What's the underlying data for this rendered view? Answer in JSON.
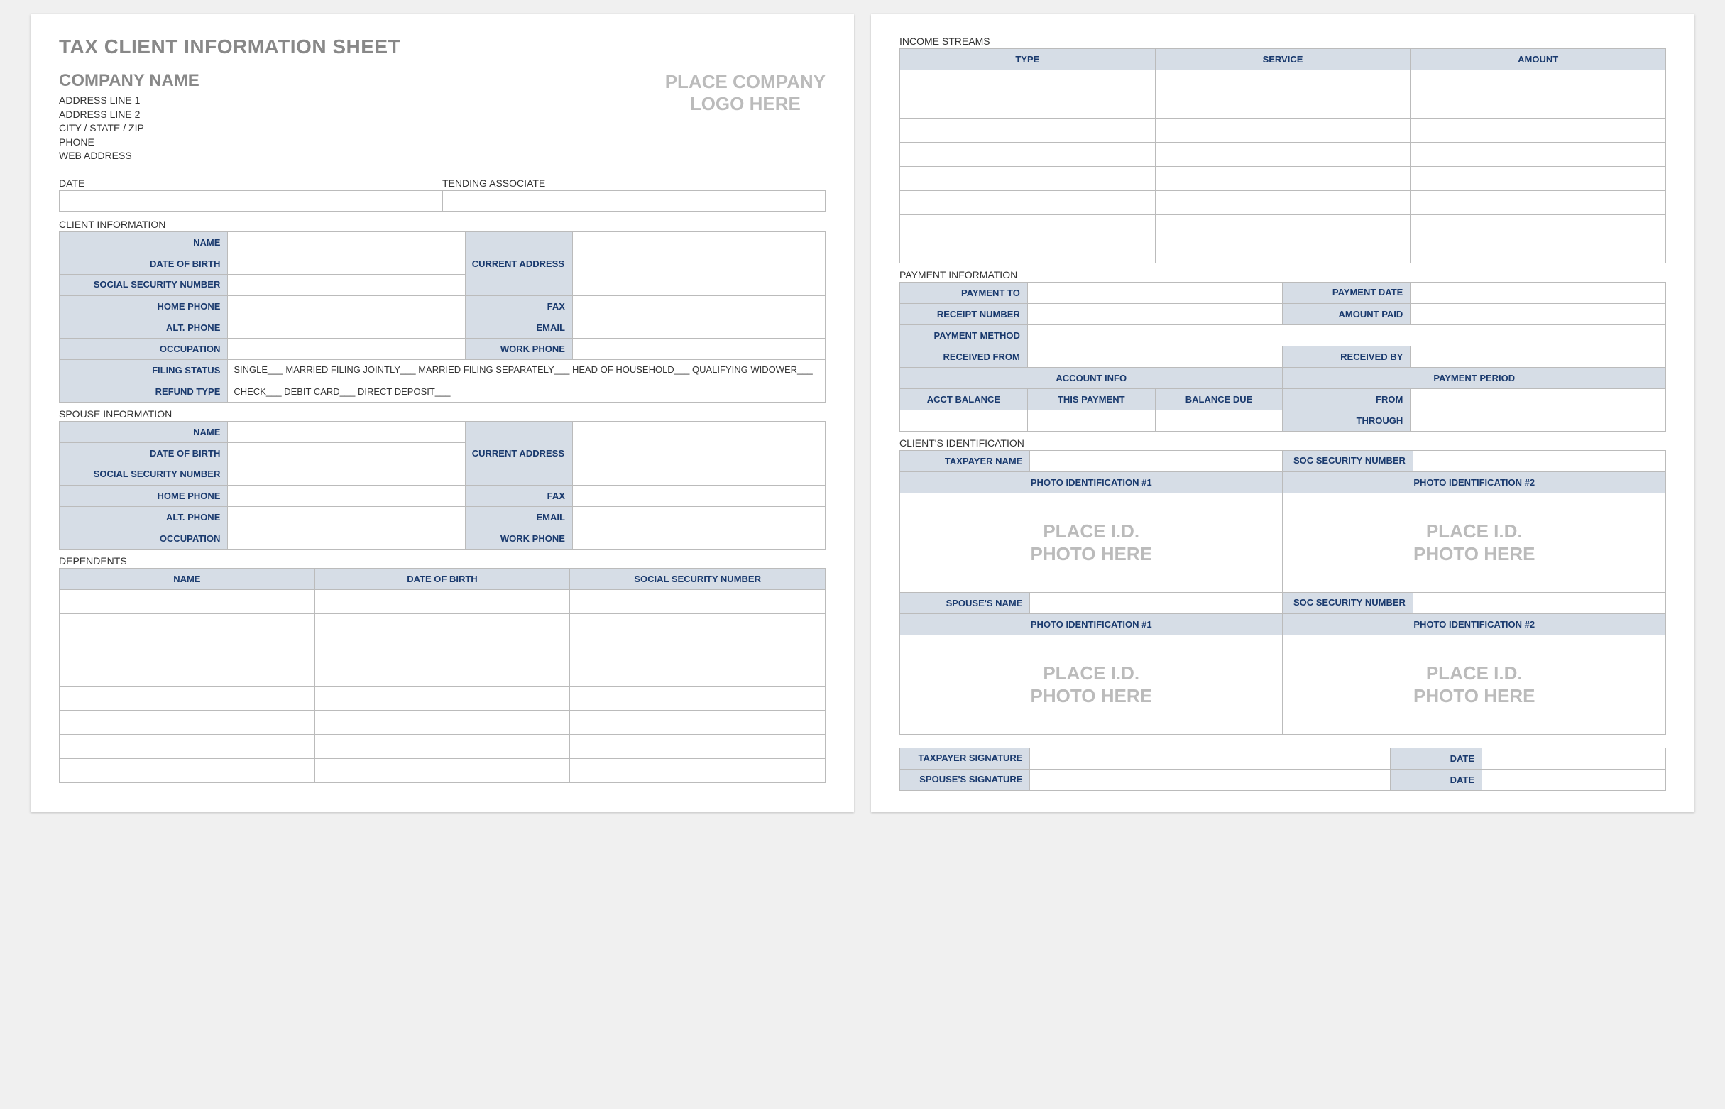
{
  "title": "TAX CLIENT INFORMATION SHEET",
  "company": {
    "name": "COMPANY NAME",
    "addr1": "ADDRESS LINE 1",
    "addr2": "ADDRESS LINE 2",
    "csz": "CITY / STATE / ZIP",
    "phone": "PHONE",
    "web": "WEB ADDRESS"
  },
  "logo_placeholder": "PLACE COMPANY\nLOGO HERE",
  "date_label": "DATE",
  "tending_label": "TENDING ASSOCIATE",
  "sections": {
    "client_info": "CLIENT INFORMATION",
    "spouse_info": "SPOUSE INFORMATION",
    "dependents": "DEPENDENTS",
    "income": "INCOME STREAMS",
    "payment": "PAYMENT INFORMATION",
    "client_id": "CLIENT'S IDENTIFICATION"
  },
  "client_fields": {
    "name": "NAME",
    "dob": "DATE OF BIRTH",
    "ssn": "SOCIAL SECURITY NUMBER",
    "current_addr": "CURRENT ADDRESS",
    "home_phone": "HOME PHONE",
    "fax": "FAX",
    "alt_phone": "ALT. PHONE",
    "email": "EMAIL",
    "occupation": "OCCUPATION",
    "work_phone": "WORK PHONE",
    "filing_status": "FILING STATUS",
    "filing_opts": "SINGLE___   MARRIED FILING JOINTLY___   MARRIED FILING SEPARATELY___   HEAD OF HOUSEHOLD___   QUALIFYING WIDOWER___",
    "refund_type": "REFUND TYPE",
    "refund_opts": "CHECK___   DEBIT CARD___   DIRECT DEPOSIT___"
  },
  "dependents_headers": {
    "name": "NAME",
    "dob": "DATE OF BIRTH",
    "ssn": "SOCIAL SECURITY NUMBER"
  },
  "income_headers": {
    "type": "TYPE",
    "service": "SERVICE",
    "amount": "AMOUNT"
  },
  "payment_fields": {
    "payment_to": "PAYMENT TO",
    "payment_date": "PAYMENT DATE",
    "receipt_no": "RECEIPT NUMBER",
    "amount_paid": "AMOUNT PAID",
    "payment_method": "PAYMENT METHOD",
    "received_from": "RECEIVED FROM",
    "received_by": "RECEIVED BY",
    "account_info": "ACCOUNT INFO",
    "payment_period": "PAYMENT PERIOD",
    "acct_balance": "ACCT BALANCE",
    "this_payment": "THIS PAYMENT",
    "balance_due": "BALANCE DUE",
    "from": "FROM",
    "through": "THROUGH"
  },
  "id_fields": {
    "taxpayer_name": "TAXPAYER NAME",
    "soc_sec": "SOC SECURITY NUMBER",
    "photo1": "PHOTO IDENTIFICATION #1",
    "photo2": "PHOTO IDENTIFICATION #2",
    "photo_placeholder": "PLACE I.D.\nPHOTO HERE",
    "spouse_name": "SPOUSE'S NAME"
  },
  "sig_fields": {
    "taxpayer_sig": "TAXPAYER SIGNATURE",
    "spouse_sig": "SPOUSE'S SIGNATURE",
    "date": "DATE"
  }
}
